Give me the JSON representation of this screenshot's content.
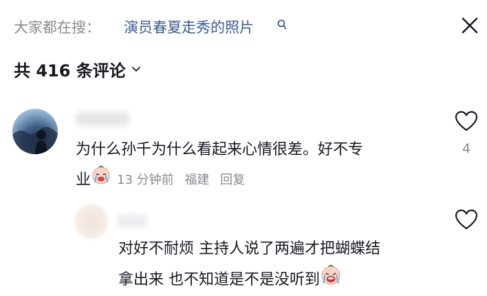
{
  "header": {
    "search_prefix": "大家都在搜：",
    "search_query": "演员春夏走秀的照片",
    "search_icon": "search-icon",
    "close_icon": "close-icon"
  },
  "comments_header": {
    "title": "共 416 条评论",
    "chevron_icon": "chevron-down-icon"
  },
  "comments": [
    {
      "text_line1": "为什么孙千为什么看起来心情很差。好不专",
      "text_line2_start": "业",
      "emoji_icon": "crying-face-emoji",
      "time": "13 分钟前",
      "location": "福建",
      "reply_label": "回复",
      "likes": "4",
      "like_icon": "heart-outline-icon"
    },
    {
      "text_line1": "对好不耐烦 主持人说了两遍才把蝴蝶结",
      "text_line2": "拿出来 也不知道是不是没听到",
      "emoji_icon": "crying-face-emoji",
      "like_icon": "heart-outline-icon"
    }
  ],
  "colors": {
    "link": "#3a5a92",
    "muted": "#8a8b91",
    "text": "#161823"
  }
}
